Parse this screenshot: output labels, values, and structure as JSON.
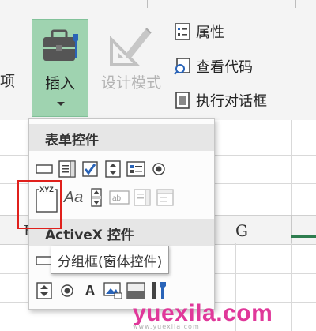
{
  "ribbon": {
    "left_partial_label": "项",
    "insert_button": {
      "label": "插入",
      "icon": "toolbox-icon"
    },
    "design_mode_button": {
      "label": "设计模式",
      "icon": "design-mode-icon"
    },
    "side_items": [
      {
        "label": "属性",
        "icon": "properties-icon"
      },
      {
        "label": "查看代码",
        "icon": "view-code-icon"
      },
      {
        "label": "执行对话框",
        "icon": "run-dialog-icon"
      }
    ]
  },
  "dropdown": {
    "form_controls_title": "表单控件",
    "form_controls_row1": [
      "button-icon",
      "combo-box-icon",
      "check-box-icon",
      "spin-button-icon",
      "list-box-icon",
      "option-button-icon"
    ],
    "form_controls_row2": [
      "group-box-icon",
      "label-icon",
      "scroll-bar-icon",
      "text-field-icon",
      "combo-list-edit-icon",
      "combo-dropdown-edit-icon"
    ],
    "label_icon_text": "Aa",
    "activex_title": "ActiveX 控件",
    "activex_row1": [
      "command-button-icon",
      "combo-box-icon"
    ],
    "activex_row2": [
      "spin-button-icon",
      "option-button-icon",
      "label-icon",
      "image-icon",
      "toggle-button-icon",
      "more-controls-icon"
    ],
    "label_a_text": "A",
    "group_box_text": "XYZ",
    "tooltip": "分组框(窗体控件)"
  },
  "sheet": {
    "column_g": "G",
    "column_e_partial": "E"
  },
  "watermark": {
    "text": "yuexila.com",
    "sub": "www.yuexila.com"
  },
  "colors": {
    "insert_active": "#9fd3b0",
    "highlight_box": "#e0201c",
    "watermark": "#e0389a",
    "checkbox_blue": "#2a64b8"
  }
}
